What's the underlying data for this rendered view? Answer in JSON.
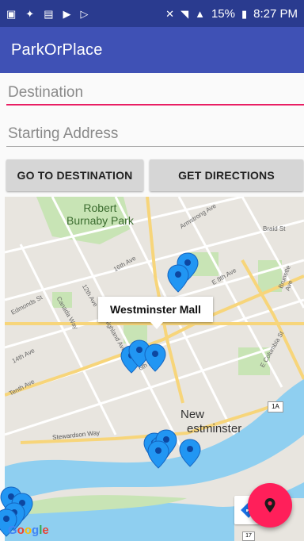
{
  "status_bar": {
    "battery": "15%",
    "time": "8:27 PM"
  },
  "app": {
    "title": "ParkOrPlace"
  },
  "form": {
    "destination_placeholder": "Destination",
    "start_placeholder": "Starting Address"
  },
  "buttons": {
    "go_to_destination": "GO TO DESTINATION",
    "get_directions": "GET DIRECTIONS"
  },
  "map": {
    "labels": {
      "park": "Robert",
      "park2": "Burnaby Park",
      "city": "New",
      "city2": "estminster",
      "armstrong": "Armstrong Ave",
      "braid": "Braid St",
      "sixteenth": "16th Ave",
      "eighth": "E 8th Ave",
      "edmonds": "Edmonds St",
      "canada": "Canada Way",
      "twelfth": "12th Ave",
      "tenth": "Tenth Ave",
      "fourteenth": "14th Ave",
      "sixth": "6th Ave",
      "lazy": "Highland Ave",
      "columbia": "E Columbia St",
      "brunette": "Brunette Ave",
      "stewardson": "Stewardson Way",
      "hwy": "1A",
      "hwy2": "17"
    },
    "info_window": "Westminster Mall",
    "logo": "Google",
    "marker_color": "#2196f3"
  }
}
